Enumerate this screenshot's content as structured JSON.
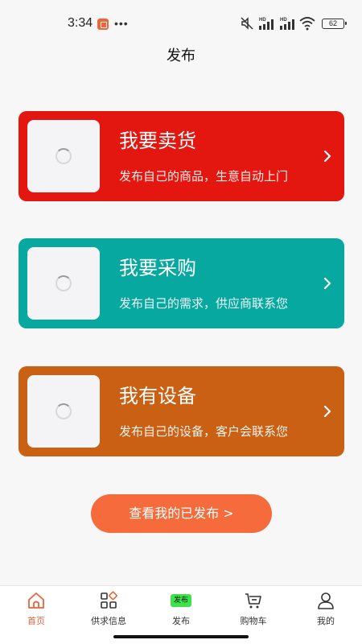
{
  "status_bar": {
    "time": "3:34",
    "more": "•••",
    "battery": "62",
    "hd_label": "HD"
  },
  "header": {
    "title": "发布"
  },
  "cards": [
    {
      "title": "我要卖货",
      "subtitle": "发布自己的商品，生意自动上门",
      "color": "#e3170f"
    },
    {
      "title": "我要采购",
      "subtitle": "发布自己的需求，供应商联系您",
      "color": "#06a89f"
    },
    {
      "title": "我有设备",
      "subtitle": "发布自己的设备，客户会联系您",
      "color": "#c96013"
    }
  ],
  "view_button": {
    "label": "查看我的已发布 >"
  },
  "nav": {
    "items": [
      {
        "label": "首页",
        "icon": "home-icon",
        "active": true
      },
      {
        "label": "供求信息",
        "icon": "grid-icon",
        "active": false
      },
      {
        "label": "发布",
        "icon": "publish-icon",
        "badge": "发布",
        "active": false
      },
      {
        "label": "购物车",
        "icon": "cart-icon",
        "active": false
      },
      {
        "label": "我的",
        "icon": "user-icon",
        "active": false
      }
    ]
  },
  "colors": {
    "accent": "#e8643d",
    "button": "#f56b3c",
    "badge": "#3ee24a"
  }
}
